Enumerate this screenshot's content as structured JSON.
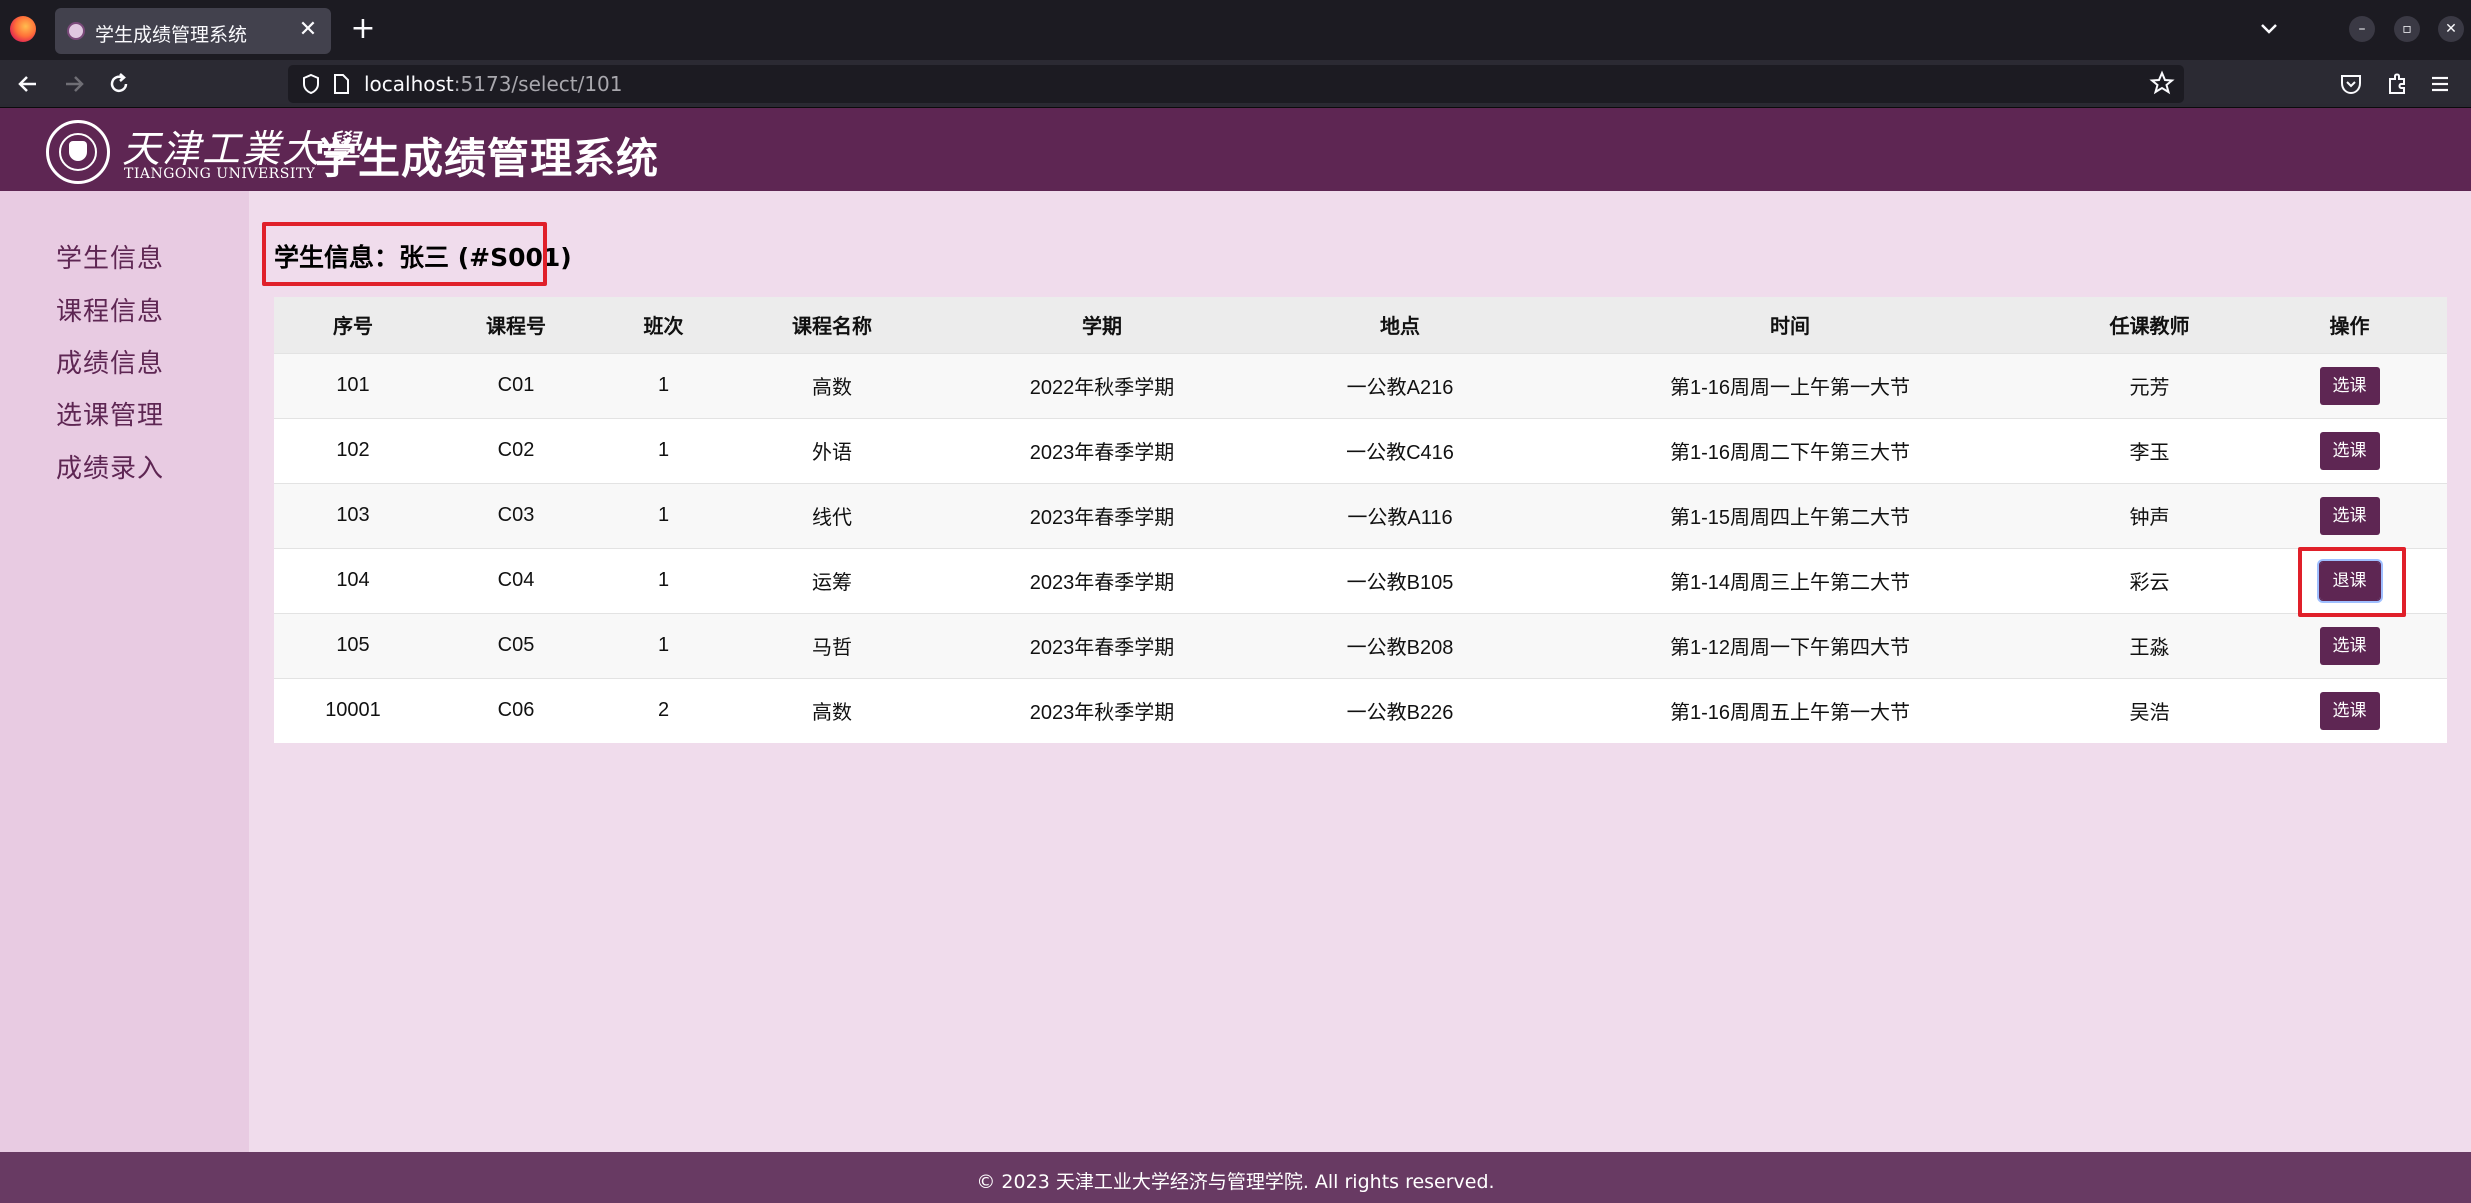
{
  "browser": {
    "tab_title": "学生成绩管理系统",
    "tab_close": "✕",
    "new_tab": "+",
    "url_host": "localhost",
    "url_path": ":5173/select/101",
    "icons": [
      "firefox-icon",
      "tab-list-chevron-icon",
      "minimize-icon",
      "restore-icon",
      "close-window-icon",
      "back-icon",
      "forward-icon",
      "reload-icon",
      "shield-icon",
      "page-icon",
      "bookmark-star-icon",
      "pocket-icon",
      "extensions-icon",
      "menu-icon"
    ],
    "window_controls": {
      "minimize": "–",
      "restore": "▫",
      "close": "✕"
    }
  },
  "header": {
    "university_cn": "天津工業大學",
    "university_en": "TIANGONG UNIVERSITY",
    "app_title": "学生成绩管理系统"
  },
  "sidebar": {
    "items": [
      {
        "label": "学生信息"
      },
      {
        "label": "课程信息"
      },
      {
        "label": "成绩信息"
      },
      {
        "label": "选课管理"
      },
      {
        "label": "成绩录入"
      }
    ]
  },
  "main": {
    "student_info": "学生信息：张三 (#S001)",
    "table": {
      "columns": [
        "序号",
        "课程号",
        "班次",
        "课程名称",
        "学期",
        "地点",
        "时间",
        "任课教师",
        "操作"
      ],
      "rows": [
        {
          "id": "101",
          "course_no": "C01",
          "section": "1",
          "name": "高数",
          "term": "2022年秋季学期",
          "location": "一公教A216",
          "time": "第1-16周周一上午第一大节",
          "teacher": "元芳",
          "action": "选课"
        },
        {
          "id": "102",
          "course_no": "C02",
          "section": "1",
          "name": "外语",
          "term": "2023年春季学期",
          "location": "一公教C416",
          "time": "第1-16周周二下午第三大节",
          "teacher": "李玉",
          "action": "选课"
        },
        {
          "id": "103",
          "course_no": "C03",
          "section": "1",
          "name": "线代",
          "term": "2023年春季学期",
          "location": "一公教A116",
          "time": "第1-15周周四上午第二大节",
          "teacher": "钟声",
          "action": "选课"
        },
        {
          "id": "104",
          "course_no": "C04",
          "section": "1",
          "name": "运筹",
          "term": "2023年春季学期",
          "location": "一公教B105",
          "time": "第1-14周周三上午第二大节",
          "teacher": "彩云",
          "action": "退课"
        },
        {
          "id": "105",
          "course_no": "C05",
          "section": "1",
          "name": "马哲",
          "term": "2023年春季学期",
          "location": "一公教B208",
          "time": "第1-12周周一下午第四大节",
          "teacher": "王淼",
          "action": "选课"
        },
        {
          "id": "10001",
          "course_no": "C06",
          "section": "2",
          "name": "高数",
          "term": "2023年秋季学期",
          "location": "一公教B226",
          "time": "第1-16周周五上午第一大节",
          "teacher": "吴浩",
          "action": "选课"
        }
      ]
    }
  },
  "footer": {
    "text": "© 2023 天津工业大学经济与管理学院. All rights reserved."
  },
  "colors": {
    "brand": "#5e2653",
    "sidebar_bg": "#e8cbe2",
    "main_bg": "#f0dcec",
    "footer_bg": "#683a63",
    "highlight": "#e0202a"
  }
}
